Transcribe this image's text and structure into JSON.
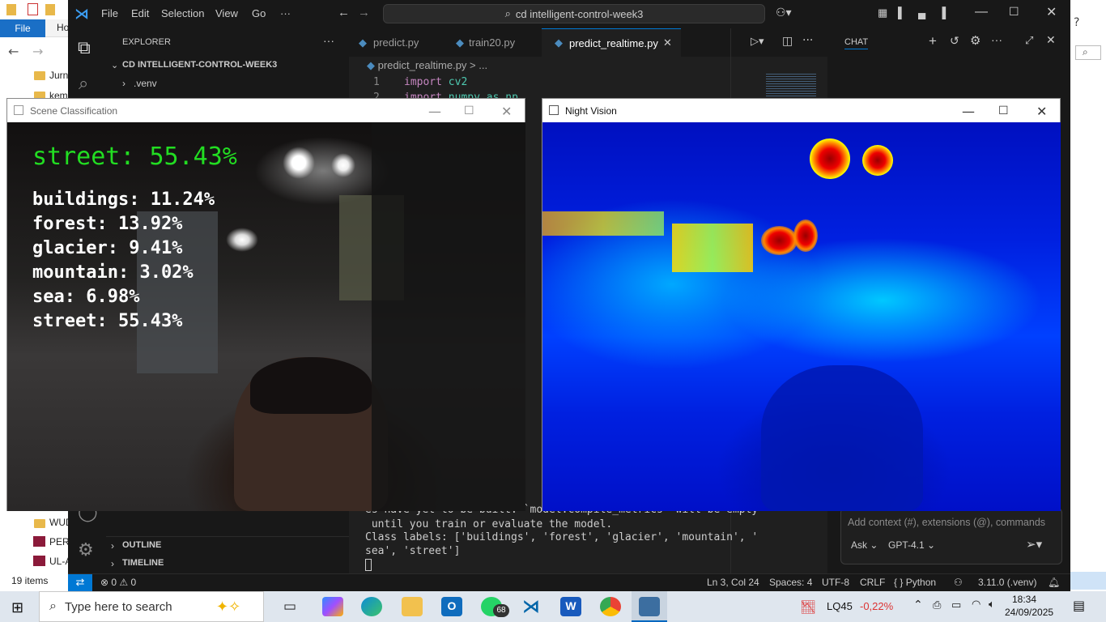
{
  "file_explorer": {
    "file_menu": "File",
    "home_tab": "Ho",
    "items": [
      "Jurn",
      "kem",
      "WUD",
      "PERA",
      "UL-A"
    ],
    "status": "19 items",
    "right_search_icon": "search-icon"
  },
  "vscode": {
    "menu": [
      "File",
      "Edit",
      "Selection",
      "View",
      "Go",
      "···"
    ],
    "command_center": "cd intelligent-control-week3",
    "explorer": {
      "title": "EXPLORER",
      "root": "CD INTELLIGENT-CONTROL-WEEK3",
      "items": [
        ".venv"
      ],
      "outline": "OUTLINE",
      "timeline": "TIMELINE"
    },
    "tabs": [
      {
        "label": "predict.py"
      },
      {
        "label": "train20.py"
      },
      {
        "label": "predict_realtime.py"
      }
    ],
    "breadcrumb": "predict_realtime.py > ...",
    "code_lines": [
      {
        "num": "1",
        "kw": "import",
        "mod": "cv2"
      },
      {
        "num": "2",
        "kw": "import",
        "mod": "numpy as np"
      }
    ],
    "terminal_lines": [
      "es have yet to be built. `model.compile_metrics` will be empty",
      " until you train or evaluate the model.",
      "Class labels: ['buildings', 'forest', 'glacier', 'mountain', '",
      "sea', 'street']"
    ],
    "chat": {
      "title": "CHAT",
      "input_placeholder": "Add context (#), extensions (@), commands",
      "mode": "Ask",
      "model": "GPT-4.1"
    },
    "statusbar": {
      "errors": "0",
      "warnings": "0",
      "position": "Ln 3, Col 24",
      "spaces": "Spaces: 4",
      "encoding": "UTF-8",
      "eol": "CRLF",
      "language": "Python",
      "interpreter": "3.11.0 (.venv)"
    }
  },
  "scene_window": {
    "title": "Scene Classification",
    "top_prediction": "street: 55.43%",
    "predictions": [
      "buildings: 11.24%",
      "forest: 13.92%",
      "glacier: 9.41%",
      "mountain: 3.02%",
      "sea: 6.98%",
      "street: 55.43%"
    ],
    "accent": "#22dd22"
  },
  "night_window": {
    "title": "Night Vision"
  },
  "taskbar": {
    "search_placeholder": "Type here to search",
    "whatsapp_badge": "68",
    "stock_name": "LQ45",
    "stock_change": "-0,22%",
    "time": "18:34",
    "date": "24/09/2025"
  }
}
